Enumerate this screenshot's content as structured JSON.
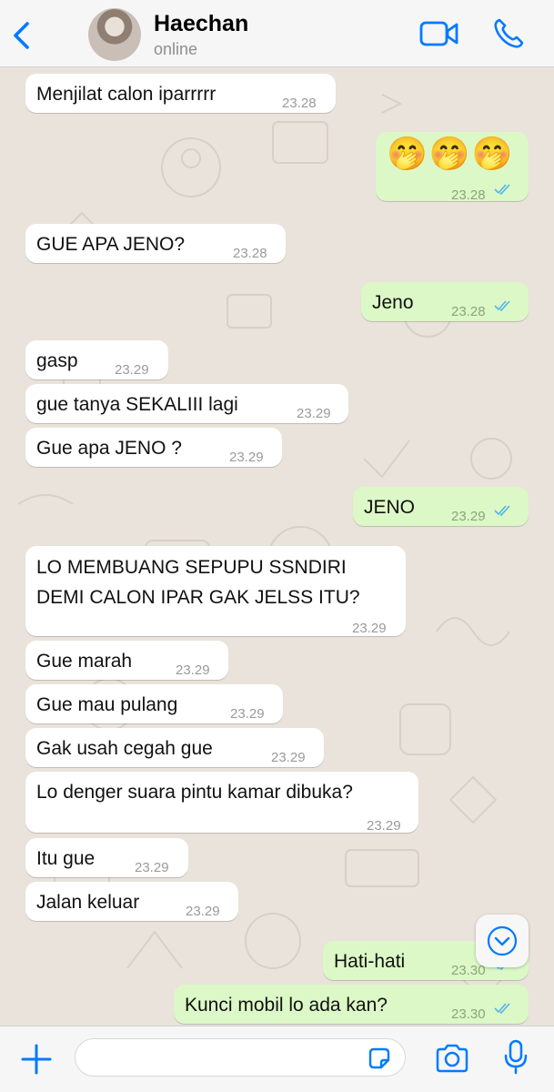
{
  "colors": {
    "accent": "#007aff",
    "incoming_bubble": "#ffffff",
    "outgoing_bubble": "#dcf8c6",
    "read_ticks": "#4fb6ec",
    "chat_background": "#ece5dd"
  },
  "header": {
    "contact_name": "Haechan",
    "contact_status": "online",
    "icons": [
      "back-chevron-icon",
      "video-camera-icon",
      "phone-icon"
    ]
  },
  "messages": [
    {
      "direction": "in",
      "text": "Menjilat calon iparrrrr",
      "time": "23.28"
    },
    {
      "direction": "out",
      "text": "🤭 🤭 🤭",
      "time": "23.28",
      "status": "read"
    },
    {
      "direction": "in",
      "text": "GUE APA JENO?",
      "time": "23.28"
    },
    {
      "direction": "out",
      "text": "Jeno",
      "time": "23.28",
      "status": "read"
    },
    {
      "direction": "in",
      "text": "gasp",
      "time": "23.29"
    },
    {
      "direction": "in",
      "text": "gue tanya SEKALIII lagi",
      "time": "23.29"
    },
    {
      "direction": "in",
      "text": "Gue apa JENO ?",
      "time": "23.29"
    },
    {
      "direction": "out",
      "text": "JENO",
      "time": "23.29",
      "status": "read"
    },
    {
      "direction": "in",
      "text_lines": [
        "LO MEMBUANG SEPUPU SSNDIRI",
        "DEMI CALON IPAR GAK JELSS ITU?"
      ],
      "time": "23.29"
    },
    {
      "direction": "in",
      "text": "Gue marah",
      "time": "23.29"
    },
    {
      "direction": "in",
      "text": "Gue mau pulang",
      "time": "23.29"
    },
    {
      "direction": "in",
      "text": "Gak usah cegah gue",
      "time": "23.29"
    },
    {
      "direction": "in",
      "text": "Lo denger suara pintu kamar dibuka?",
      "time": "23.29"
    },
    {
      "direction": "in",
      "text": "Itu gue",
      "time": "23.29"
    },
    {
      "direction": "in",
      "text": "Jalan keluar",
      "time": "23.29"
    },
    {
      "direction": "out",
      "text": "Hati-hati",
      "time": "23.30",
      "status": "read"
    },
    {
      "direction": "out",
      "text": "Kunci mobil lo ada kan?",
      "time": "23.30",
      "status": "read"
    }
  ],
  "scroll_down_icon": "chevron-down-circle-icon",
  "footer": {
    "icons": [
      "plus-icon",
      "sticker-icon",
      "camera-icon",
      "microphone-icon"
    ],
    "input_value": ""
  }
}
